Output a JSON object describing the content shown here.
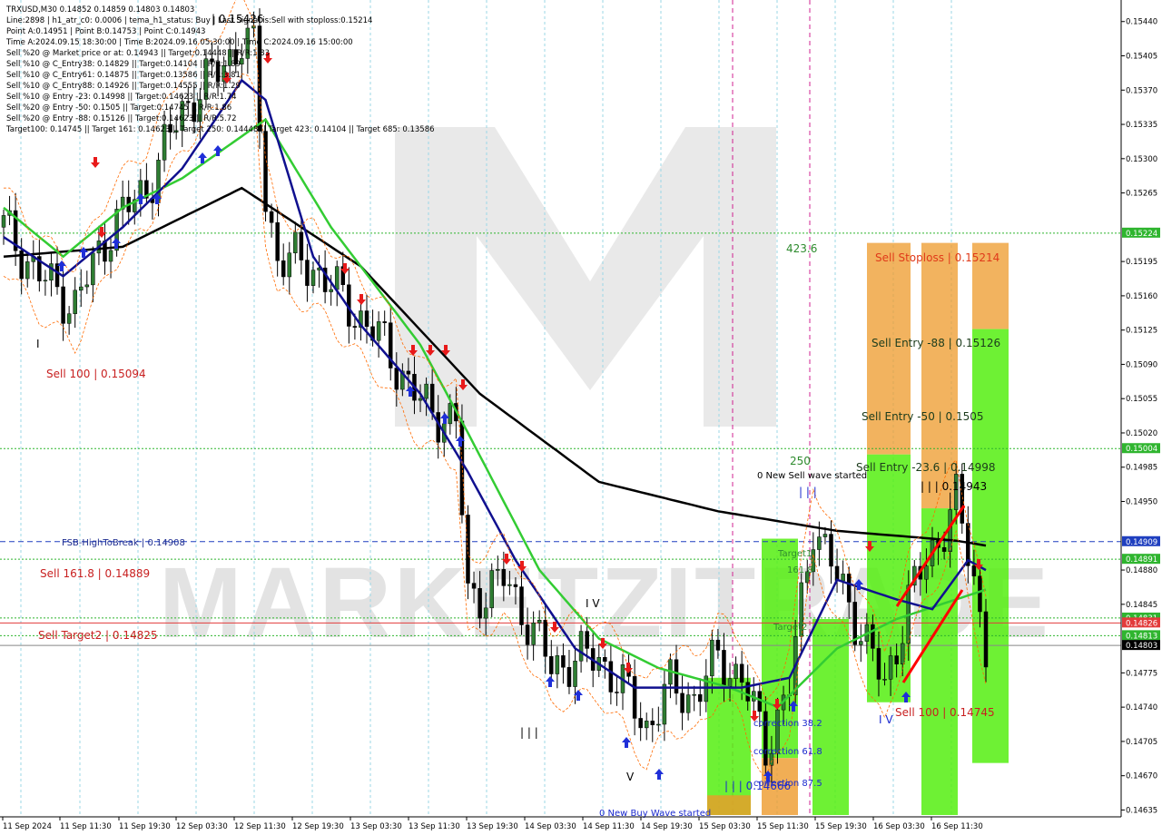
{
  "info_lines": [
    "TRXUSD,M30  0.14852 0.14859 0.14803 0.14803",
    "Line:2898 | h1_atr_c0: 0.0006 | tema_h1_status: Buy | Last Signal is:Sell with stoploss:0.15214",
    "Point A:0.14951 | Point B:0.14753 | Point C:0.14943",
    "Time A:2024.09.15 18:30:00 | Time B:2024.09.16 05:30:00 | Time C:2024.09.16 15:00:00",
    "Sell %20 @ Market price or at: 0.14943 || Target:0.14448 || R/R:1.83",
    "Sell %10 @ C_Entry38: 0.14829 || Target:0.14104 || R/R:1.89",
    "Sell %10 @ C_Entry61: 0.14875 || Target:0.13586 || R/R:3.81",
    "Sell %10 @ C_Entry88: 0.14926 || Target:0.14555 || R/R:1.29",
    "Sell %10 @ Entry -23: 0.14998 || Target:0.14623 || R/R:1.74",
    "Sell %20 @ Entry -50: 0.1505 || Target:0.14745 || R/R:1.86",
    "Sell %20 @ Entry -88: 0.15126 || Target:0.14623 || R/R:5.72",
    "Target100: 0.14745 || Target 161: 0.14623 || Target 250: 0.14448 || Target 423: 0.14104 || Target 685: 0.13586"
  ],
  "price_axis": {
    "ticks": [
      "0.15440",
      "0.15405",
      "0.15370",
      "0.15335",
      "0.15300",
      "0.15265",
      "0.15195",
      "0.15160",
      "0.15125",
      "0.15090",
      "0.15055",
      "0.15020",
      "0.14985",
      "0.14950",
      "0.14880",
      "0.14845",
      "0.14775",
      "0.14740",
      "0.14705",
      "0.14670",
      "0.14635"
    ],
    "badges": [
      {
        "text": "0.15224",
        "color": "#2fb52f"
      },
      {
        "text": "0.15004",
        "color": "#2fb52f"
      },
      {
        "text": "0.14909",
        "color": "#1f3fbf"
      },
      {
        "text": "0.14891",
        "color": "#2fb52f"
      },
      {
        "text": "0.14831",
        "color": "#2fb52f"
      },
      {
        "text": "0.14826",
        "color": "#e23b3b"
      },
      {
        "text": "0.14813",
        "color": "#2fb52f"
      },
      {
        "text": "0.14803",
        "color": "#000000"
      }
    ]
  },
  "time_axis": [
    "11 Sep 2024",
    "11 Sep 11:30",
    "11 Sep 19:30",
    "12 Sep 03:30",
    "12 Sep 11:30",
    "12 Sep 19:30",
    "13 Sep 03:30",
    "13 Sep 11:30",
    "13 Sep 19:30",
    "14 Sep 03:30",
    "14 Sep 11:30",
    "14 Sep 19:30",
    "15 Sep 03:30",
    "15 Sep 11:30",
    "15 Sep 19:30",
    "16 Sep 03:30",
    "16 Sep 11:30"
  ],
  "labels": {
    "high_label": "| 0.15426",
    "sell100_left": "Sell 100 | 0.15094",
    "fsb": "FSB-HighToBreak | 0.14908",
    "sell161": "Sell 161.8 | 0.14889",
    "sell_target2": "Sell Target2 | 0.14825",
    "lvl_423": "423.6",
    "lvl_250": "250",
    "new_sell_wave": "0 New Sell wave started",
    "new_buy_wave": "0 New Buy Wave started",
    "sell_stoploss": "Sell Stoploss | 0.15214",
    "sell_entry_88": "Sell Entry -88 | 0.15126",
    "sell_entry_50": "Sell Entry -50 | 0.1505",
    "sell_entry_236": "Sell Entry -23.6 | 0.14998",
    "point_c": "| | | 0.14943",
    "sell100_right": "Sell 100 | 0.14745",
    "target1": "Target1",
    "lvl_1618": "161.8",
    "target2": "Target2",
    "corr382": "correction 38.2",
    "corr618": "correction 61.8",
    "corr875": "correction 87.5",
    "low_val": "| | | 0.14666",
    "wave_iii_a": "| | |",
    "wave_iv_a": "I V",
    "wave_v_a": "V",
    "wave_iii_b": "| | |",
    "wave_iv_b": "I V",
    "wave_i": "I"
  },
  "chart_data": {
    "type": "candlestick",
    "symbol": "TRXUSD",
    "timeframe": "M30",
    "ylim": [
      0.14628,
      0.15462
    ],
    "xlabel": "",
    "ylabel": "",
    "ohlc_last": {
      "open": 0.14852,
      "high": 0.14859,
      "low": 0.14803,
      "close": 0.14803
    },
    "horizontal_levels": [
      {
        "price": 0.15224,
        "style": "dotted",
        "color": "#2fb52f"
      },
      {
        "price": 0.15004,
        "style": "dotted",
        "color": "#2fb52f"
      },
      {
        "price": 0.14909,
        "style": "dashed",
        "color": "#1f3fbf"
      },
      {
        "price": 0.14891,
        "style": "dotted",
        "color": "#2fb52f"
      },
      {
        "price": 0.14831,
        "style": "dotted",
        "color": "#2fb52f"
      },
      {
        "price": 0.14826,
        "style": "solid",
        "color": "#e23b3b"
      },
      {
        "price": 0.14813,
        "style": "dotted",
        "color": "#2fb52f"
      },
      {
        "price": 0.14803,
        "style": "solid",
        "color": "#888888"
      }
    ],
    "close_path": [
      [
        0,
        0.1523
      ],
      [
        6,
        0.1518
      ],
      [
        12,
        0.1515
      ],
      [
        18,
        0.1523
      ],
      [
        24,
        0.1527
      ],
      [
        30,
        0.1535
      ],
      [
        36,
        0.1539
      ],
      [
        40,
        0.1542
      ],
      [
        42,
        0.1541
      ],
      [
        44,
        0.1526
      ],
      [
        46,
        0.152
      ],
      [
        52,
        0.1519
      ],
      [
        58,
        0.1515
      ],
      [
        64,
        0.1511
      ],
      [
        70,
        0.1505
      ],
      [
        76,
        0.1503
      ],
      [
        78,
        0.1485
      ],
      [
        84,
        0.1487
      ],
      [
        88,
        0.1483
      ],
      [
        92,
        0.1478
      ],
      [
        96,
        0.1479
      ],
      [
        100,
        0.1479
      ],
      [
        104,
        0.1476
      ],
      [
        108,
        0.1472
      ],
      [
        112,
        0.1476
      ],
      [
        116,
        0.1475
      ],
      [
        120,
        0.1479
      ],
      [
        124,
        0.1477
      ],
      [
        128,
        0.147
      ],
      [
        132,
        0.1476
      ],
      [
        136,
        0.1493
      ],
      [
        140,
        0.1487
      ],
      [
        144,
        0.1482
      ],
      [
        148,
        0.1476
      ],
      [
        152,
        0.1485
      ],
      [
        156,
        0.149
      ],
      [
        160,
        0.1495
      ],
      [
        163,
        0.1487
      ],
      [
        165,
        0.14803
      ]
    ],
    "indicators": [
      {
        "name": "",
        "color": "#000000",
        "points": [
          [
            0,
            0.152
          ],
          [
            20,
            0.1521
          ],
          [
            40,
            0.1527
          ],
          [
            60,
            0.1519
          ],
          [
            80,
            0.1506
          ],
          [
            100,
            0.1497
          ],
          [
            120,
            0.1494
          ],
          [
            140,
            0.1492
          ],
          [
            160,
            0.1491
          ],
          [
            165,
            0.14905
          ]
        ]
      },
      {
        "name": "",
        "color": "#33cc33",
        "points": [
          [
            0,
            0.1525
          ],
          [
            10,
            0.152
          ],
          [
            20,
            0.1525
          ],
          [
            30,
            0.1528
          ],
          [
            44,
            0.1534
          ],
          [
            55,
            0.1523
          ],
          [
            70,
            0.1511
          ],
          [
            78,
            0.1502
          ],
          [
            90,
            0.1488
          ],
          [
            100,
            0.1481
          ],
          [
            110,
            0.1478
          ],
          [
            122,
            0.1476
          ],
          [
            130,
            0.1474
          ],
          [
            140,
            0.148
          ],
          [
            150,
            0.1483
          ],
          [
            160,
            0.1485
          ],
          [
            165,
            0.1486
          ]
        ]
      },
      {
        "name": "",
        "color": "#10108f",
        "points": [
          [
            0,
            0.1522
          ],
          [
            10,
            0.1518
          ],
          [
            20,
            0.1523
          ],
          [
            30,
            0.1529
          ],
          [
            40,
            0.1538
          ],
          [
            44,
            0.1536
          ],
          [
            52,
            0.152
          ],
          [
            60,
            0.1513
          ],
          [
            70,
            0.1506
          ],
          [
            78,
            0.1498
          ],
          [
            86,
            0.1489
          ],
          [
            96,
            0.148
          ],
          [
            106,
            0.1476
          ],
          [
            116,
            0.1476
          ],
          [
            124,
            0.1476
          ],
          [
            132,
            0.1477
          ],
          [
            140,
            0.1487
          ],
          [
            150,
            0.1485
          ],
          [
            156,
            0.1484
          ],
          [
            162,
            0.1489
          ],
          [
            165,
            0.1488
          ]
        ]
      }
    ],
    "zones": [
      {
        "from": 0.15214,
        "to": 0.14998,
        "color": "#ee9a2a"
      },
      {
        "from": 0.14998,
        "to": 0.14745,
        "color": "#33dd11"
      }
    ]
  }
}
